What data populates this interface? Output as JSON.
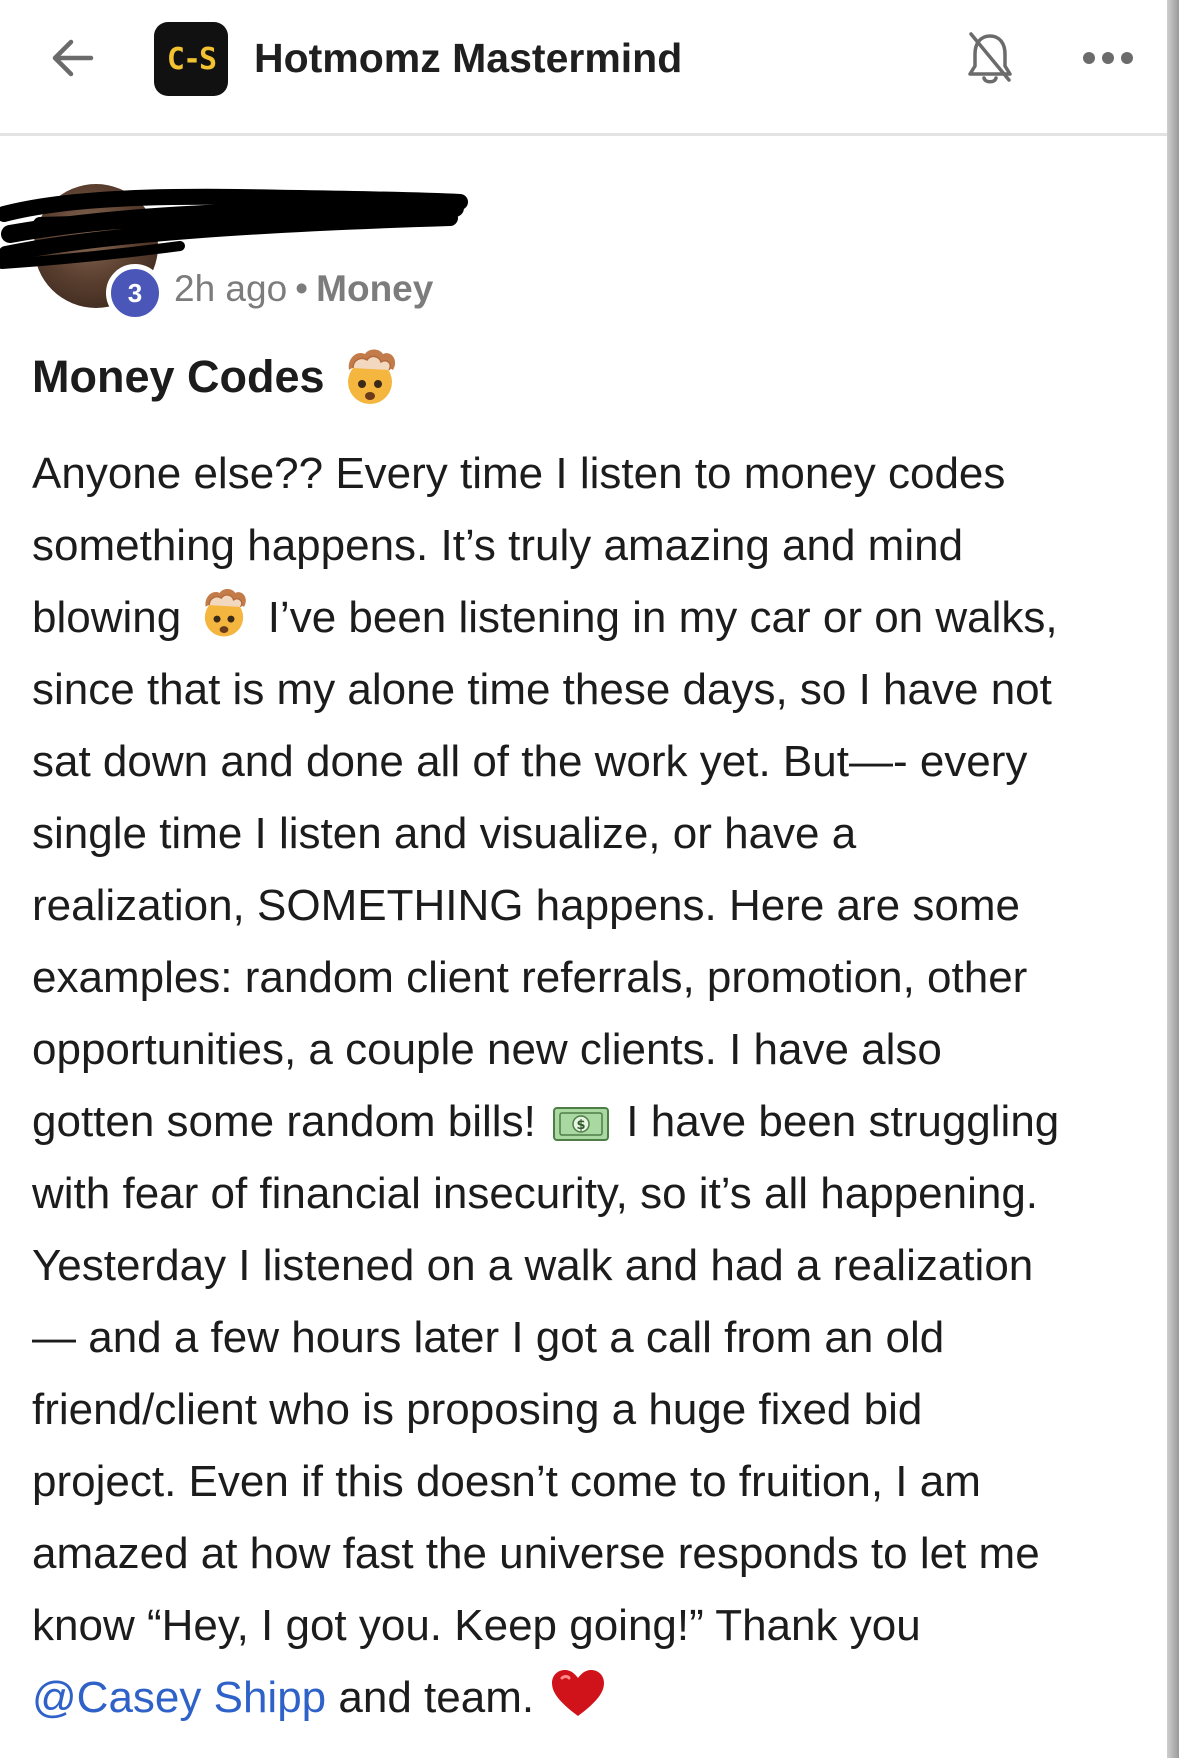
{
  "header": {
    "back_icon": "arrow-left-icon",
    "logo_text": "C-S",
    "group_name": "Hotmomz Mastermind",
    "bell_icon": "bell-icon",
    "more_icon": "more-horizontal-icon"
  },
  "post": {
    "author_level": "3",
    "time_ago": "2h ago",
    "separator": "•",
    "category": "Money",
    "title": "Money Codes",
    "title_emoji": "exploding-head-emoji",
    "body_lines": [
      "Anyone else?? Every time I listen to money codes",
      "something happens. It’s truly amazing and mind",
      "blowing",
      "I’ve been listening in my car or on walks,",
      "since that is my alone time these days, so I have not",
      "sat down and done all of the work yet. But—- every",
      "single time I listen and visualize, or have a",
      "realization, SOMETHING happens. Here are some",
      "examples: random client referrals, promotion, other",
      "opportunities, a couple new clients. I have also",
      "gotten some random bills!",
      "I have been struggling",
      "with fear of financial insecurity, so it’s all happening.",
      "Yesterday I listened on a walk and had a realization",
      "— and a few hours later I got a call from an old",
      "friend/client who is proposing a huge fixed bid",
      "project. Even if this doesn’t come to fruition, I am",
      "amazed at how fast the universe responds to let me",
      "know “Hey, I got you. Keep going!” Thank you",
      "@Casey Shipp",
      "and team."
    ]
  },
  "colors": {
    "text": "#1c1c1c",
    "muted": "#7c7c7c",
    "mention": "#2f62c9",
    "badge": "#4a57b8",
    "logo_bg": "#111111",
    "logo_fg": "#f2c230"
  }
}
